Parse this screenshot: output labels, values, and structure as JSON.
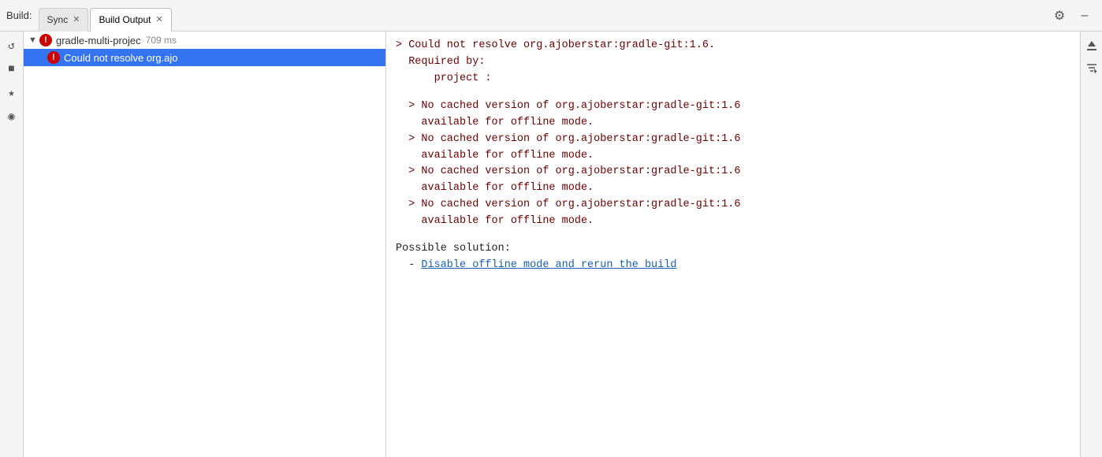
{
  "tabbar": {
    "build_label": "Build:",
    "tabs": [
      {
        "id": "sync",
        "label": "Sync",
        "active": false
      },
      {
        "id": "build-output",
        "label": "Build Output",
        "active": true
      }
    ]
  },
  "sidebar_icons": [
    {
      "name": "refresh-icon",
      "glyph": "↺"
    },
    {
      "name": "stop-icon",
      "glyph": "■"
    },
    {
      "name": "pin-icon",
      "glyph": "★"
    },
    {
      "name": "eye-icon",
      "glyph": "◉"
    }
  ],
  "tree": {
    "items": [
      {
        "id": "gradle-multi-project",
        "label": "gradle-multi-projec",
        "time": "709 ms",
        "has_error": true,
        "expanded": true,
        "indent": 0
      },
      {
        "id": "could-not-resolve",
        "label": "Could not resolve org.ajo",
        "has_error": true,
        "selected": true,
        "indent": 1
      }
    ]
  },
  "output": {
    "lines": [
      {
        "text": "> Could not resolve org.ajoberstar:gradle-git:1.6.",
        "type": "error"
      },
      {
        "text": "  Required by:",
        "type": "error"
      },
      {
        "text": "      project :",
        "type": "error"
      },
      {
        "text": "",
        "type": "blank"
      },
      {
        "text": "  > No cached version of org.ajoberstar:gradle-git:1.6",
        "type": "error"
      },
      {
        "text": "    available for offline mode.",
        "type": "error"
      },
      {
        "text": "  > No cached version of org.ajoberstar:gradle-git:1.6",
        "type": "error"
      },
      {
        "text": "    available for offline mode.",
        "type": "error"
      },
      {
        "text": "  > No cached version of org.ajoberstar:gradle-git:1.6",
        "type": "error"
      },
      {
        "text": "    available for offline mode.",
        "type": "error"
      },
      {
        "text": "  > No cached version of org.ajoberstar:gradle-git:1.6",
        "type": "error"
      },
      {
        "text": "    available for offline mode.",
        "type": "error"
      },
      {
        "text": "",
        "type": "blank"
      },
      {
        "text": "Possible solution:",
        "type": "black"
      },
      {
        "text": "  - ",
        "type": "black",
        "link": "Disable offline mode and rerun the build",
        "link_id": "disable-offline-link"
      }
    ]
  },
  "right_actions": [
    {
      "name": "scroll-to-end-icon",
      "glyph": "⇥"
    },
    {
      "name": "filter-icon",
      "glyph": "≡↓"
    }
  ],
  "toolbar": {
    "settings_label": "⚙",
    "minimize_label": "–"
  }
}
